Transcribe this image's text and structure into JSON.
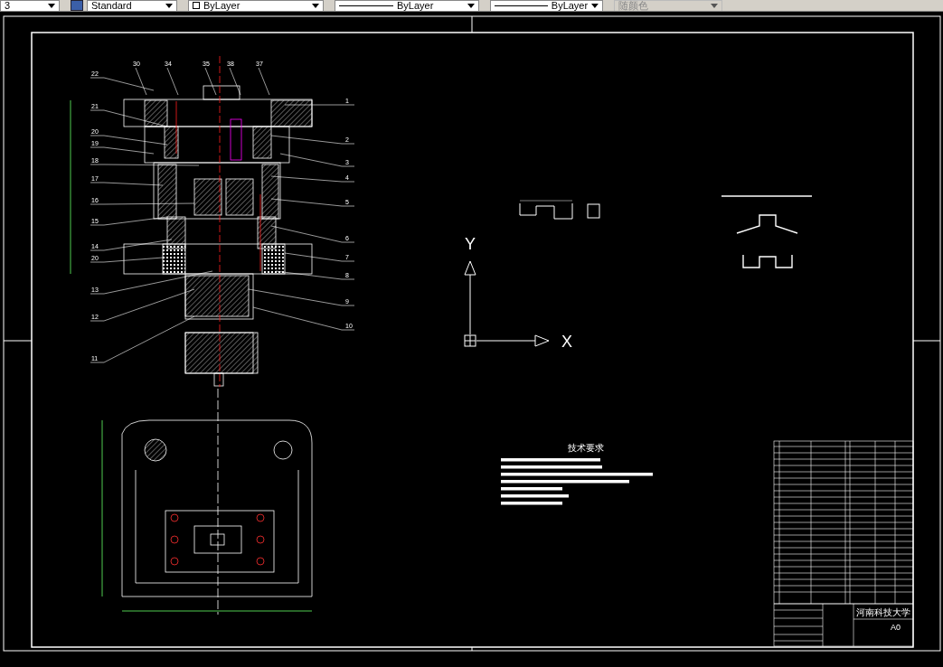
{
  "toolbar": {
    "items": [
      {
        "kind": "combo",
        "text": "3",
        "disabled": false
      },
      {
        "kind": "style",
        "text": "Standard",
        "disabled": false
      },
      {
        "kind": "color",
        "text": "ByLayer",
        "disabled": false
      },
      {
        "kind": "linetype",
        "text": "ByLayer",
        "disabled": false
      },
      {
        "kind": "lineweight",
        "text": "ByLayer",
        "disabled": false
      },
      {
        "kind": "plotstyle",
        "text": "随颜色",
        "disabled": true
      }
    ]
  },
  "drawing": {
    "top_labels": [
      "30",
      "34",
      "35",
      "38",
      "37"
    ],
    "left_labels": [
      "22",
      "21",
      "20",
      "19",
      "18",
      "17",
      "16",
      "15",
      "14",
      "20",
      "13",
      "12",
      "11"
    ],
    "right_labels": [
      "1",
      "2",
      "3",
      "4",
      "5",
      "6",
      "7",
      "8",
      "9",
      "10"
    ],
    "notes_title": "技术要求",
    "axis": {
      "y": "Y",
      "x": "X"
    },
    "title_block": {
      "school": "河南科技大学",
      "sheet_size": "A0"
    }
  }
}
